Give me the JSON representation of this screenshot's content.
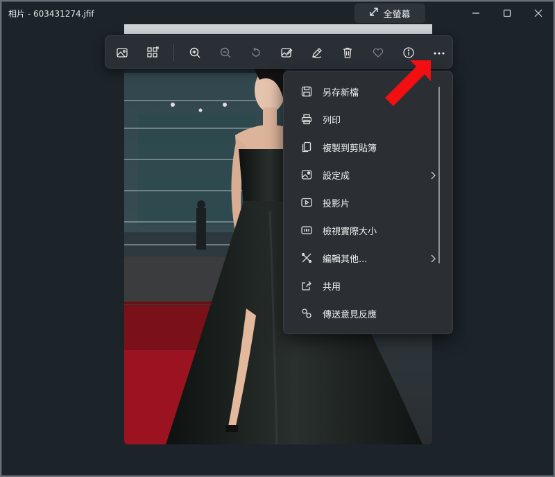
{
  "window": {
    "title": "相片 - 603431274.jfif",
    "fullscreen_label": "全螢幕"
  },
  "toolbar": {
    "buttons": [
      {
        "name": "view-image",
        "icon": "image-icon"
      },
      {
        "name": "gallery",
        "icon": "gallery-icon"
      },
      {
        "name": "zoom-in",
        "icon": "zoom-in-icon"
      },
      {
        "name": "zoom-out",
        "icon": "zoom-out-icon"
      },
      {
        "name": "rotate",
        "icon": "rotate-icon"
      },
      {
        "name": "edit-image",
        "icon": "edit-image-icon"
      },
      {
        "name": "markup",
        "icon": "pen-icon"
      },
      {
        "name": "delete",
        "icon": "trash-icon"
      },
      {
        "name": "favorite",
        "icon": "heart-icon"
      },
      {
        "name": "info",
        "icon": "info-icon"
      },
      {
        "name": "more",
        "icon": "more-icon"
      }
    ]
  },
  "menu": {
    "items": [
      {
        "label": "另存新檔",
        "icon": "save-icon"
      },
      {
        "label": "列印",
        "icon": "printer-icon"
      },
      {
        "label": "複製到剪貼簿",
        "icon": "copy-icon"
      },
      {
        "label": "設定成",
        "icon": "set-as-icon",
        "submenu": true
      },
      {
        "label": "投影片",
        "icon": "slideshow-icon"
      },
      {
        "label": "檢視實際大小",
        "icon": "actual-size-icon"
      },
      {
        "label": "編輯其他...",
        "icon": "edit-other-icon",
        "submenu": true
      },
      {
        "label": "共用",
        "icon": "share-icon"
      },
      {
        "label": "傳送意見反應",
        "icon": "feedback-icon"
      }
    ]
  },
  "colors": {
    "window_bg": "#1c2329",
    "toolbar_bg": "#2a2f35",
    "menu_bg": "#2b2f34",
    "annotation_arrow": "#f20f12"
  }
}
